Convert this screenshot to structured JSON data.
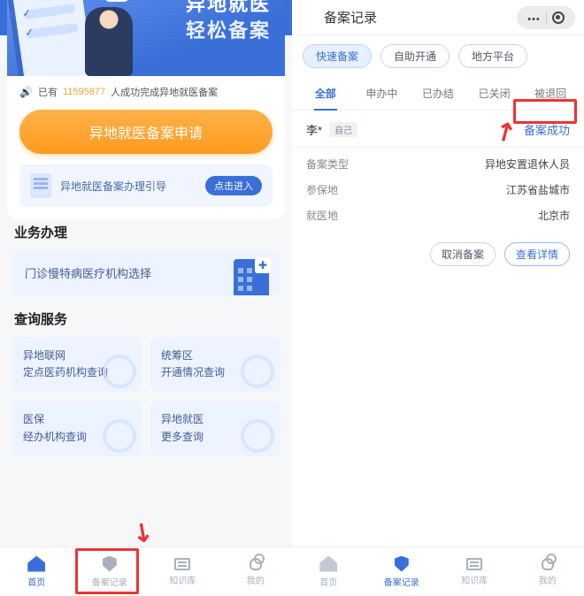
{
  "colors": {
    "accent": "#3a6fd8",
    "warn": "#ff9a1f",
    "highlight": "#e33"
  },
  "left": {
    "title": "异地就医",
    "hero_line1": "异地就医",
    "hero_line2": "轻松备案",
    "count_prefix": "已有",
    "count_value": "11595877",
    "count_suffix": "人成功完成异地就医备案",
    "apply_button": "异地就医备案申请",
    "guide_text": "异地就医备案办理引导",
    "guide_enter": "点击进入",
    "biz_title": "业务办理",
    "biz_card": "门诊慢特病医疗机构选择",
    "query_title": "查询服务",
    "grid": [
      {
        "l1": "异地联网",
        "l2": "定点医药机构查询"
      },
      {
        "l1": "统筹区",
        "l2": "开通情况查询"
      },
      {
        "l1": "医保",
        "l2": "经办机构查询"
      },
      {
        "l1": "异地就医",
        "l2": "更多查询"
      }
    ]
  },
  "right": {
    "title": "备案记录",
    "filters": [
      "快速备案",
      "自助开通",
      "地方平台"
    ],
    "filter_active": 0,
    "tabs": [
      "全部",
      "申办中",
      "已办结",
      "已关闭",
      "被退回"
    ],
    "tab_active": 0,
    "record": {
      "name": "李*",
      "relation": "自己",
      "status": "备案成功",
      "rows": [
        {
          "k": "备案类型",
          "v": "异地安置退休人员"
        },
        {
          "k": "参保地",
          "v": "江苏省盐城市"
        },
        {
          "k": "就医地",
          "v": "北京市"
        }
      ],
      "cancel": "取消备案",
      "detail": "查看详情"
    }
  },
  "tabbar": {
    "items": [
      "首页",
      "备案记录",
      "知识库",
      "我的"
    ]
  }
}
